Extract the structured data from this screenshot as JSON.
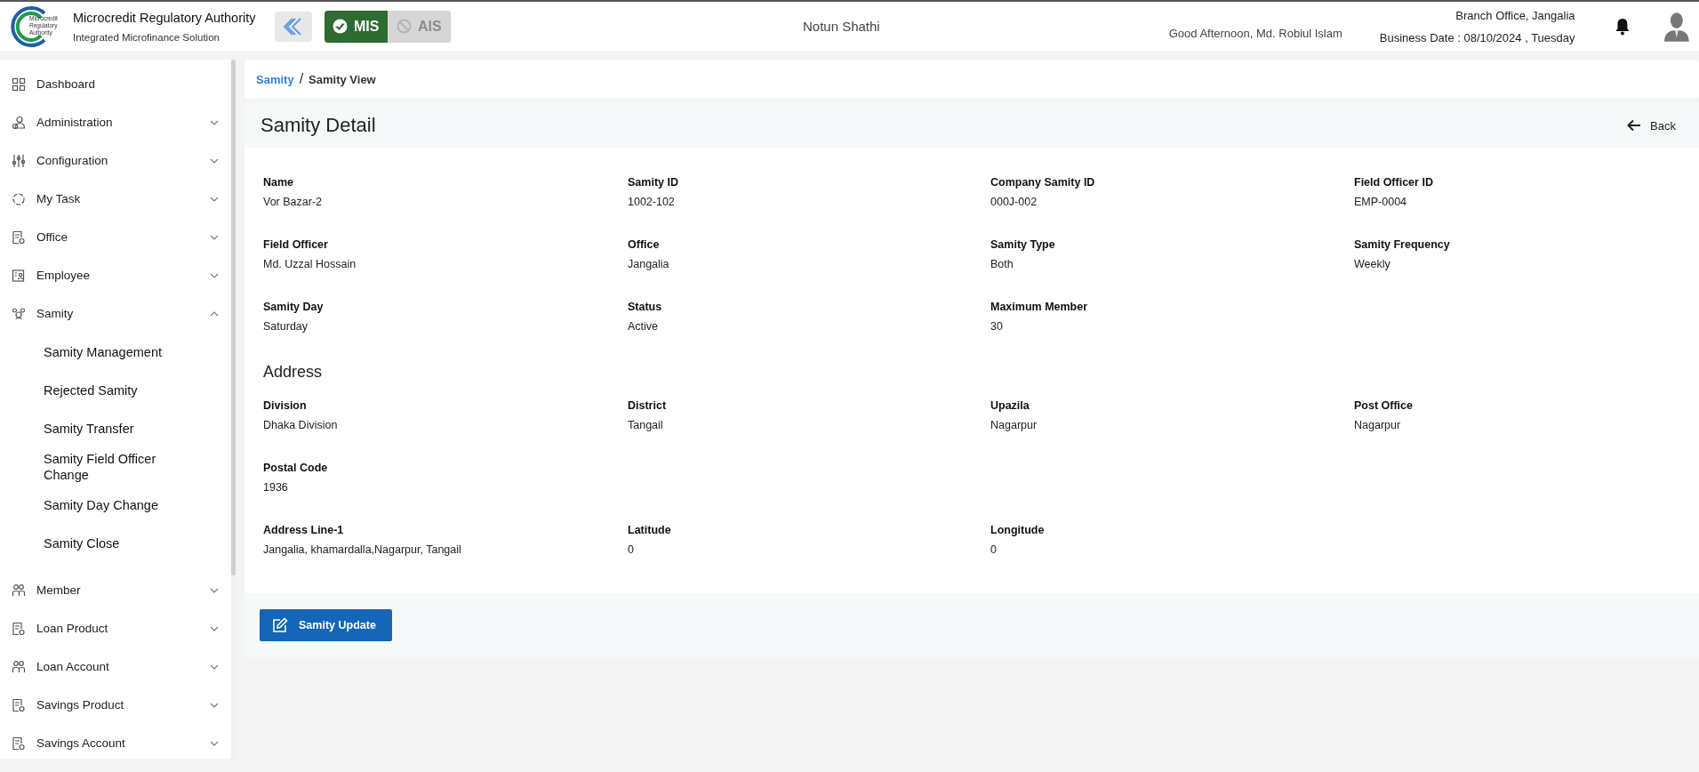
{
  "header": {
    "logo_text": [
      "Microcredit",
      "Regulatory",
      "Authority"
    ],
    "org_name": "Microcredit Regulatory Authority",
    "org_subtitle": "Integrated Microfinance Solution",
    "modules": [
      {
        "label": "MIS",
        "selected": true
      },
      {
        "label": "AIS",
        "selected": false
      }
    ],
    "ngo_name": "Notun Shathi",
    "greeting": "Good Afternoon, Md. Robiul Islam",
    "branch": "Branch Office, Jangalia",
    "business_date": "Business Date : 08/10/2024 , Tuesday"
  },
  "sidebar": {
    "items": [
      {
        "label": "Dashboard",
        "kind": "link"
      },
      {
        "label": "Administration",
        "kind": "group",
        "expanded": false
      },
      {
        "label": "Configuration",
        "kind": "group",
        "expanded": false
      },
      {
        "label": "My Task",
        "kind": "group",
        "expanded": false
      },
      {
        "label": "Office",
        "kind": "group",
        "expanded": false
      },
      {
        "label": "Employee",
        "kind": "group",
        "expanded": false
      },
      {
        "label": "Samity",
        "kind": "group",
        "expanded": true,
        "children": [
          {
            "label": "Samity Management"
          },
          {
            "label": "Rejected Samity"
          },
          {
            "label": "Samity Transfer"
          },
          {
            "label": "Samity Field Officer Change"
          },
          {
            "label": "Samity Day Change"
          },
          {
            "label": "Samity Close"
          }
        ]
      },
      {
        "label": "Member",
        "kind": "group",
        "expanded": false
      },
      {
        "label": "Loan Product",
        "kind": "group",
        "expanded": false
      },
      {
        "label": "Loan Account",
        "kind": "group",
        "expanded": false
      },
      {
        "label": "Savings Product",
        "kind": "group",
        "expanded": false
      },
      {
        "label": "Savings Account",
        "kind": "group",
        "expanded": false
      }
    ]
  },
  "breadcrumb": {
    "link": "Samity",
    "separator": "/",
    "current": "Samity View"
  },
  "detail": {
    "title": "Samity Detail",
    "back": "Back",
    "sections": [
      {
        "rows": [
          [
            {
              "label": "Name",
              "value": "Vor Bazar-2"
            },
            {
              "label": "Samity ID",
              "value": "1002-102"
            },
            {
              "label": "Company Samity ID",
              "value": "000J-002"
            },
            {
              "label": "Field Officer ID",
              "value": "EMP-0004"
            }
          ],
          [
            {
              "label": "Field Officer",
              "value": "Md. Uzzal Hossain"
            },
            {
              "label": "Office",
              "value": "Jangalia"
            },
            {
              "label": "Samity Type",
              "value": "Both"
            },
            {
              "label": "Samity Frequency",
              "value": "Weekly"
            }
          ],
          [
            {
              "label": "Samity Day",
              "value": "Saturday"
            },
            {
              "label": "Status",
              "value": "Active"
            },
            {
              "label": "Maximum Member",
              "value": "30"
            }
          ]
        ]
      },
      {
        "heading": "Address",
        "rows": [
          [
            {
              "label": "Division",
              "value": "Dhaka Division"
            },
            {
              "label": "District",
              "value": "Tangail"
            },
            {
              "label": "Upazila",
              "value": "Nagarpur"
            },
            {
              "label": "Post Office",
              "value": "Nagarpur"
            }
          ],
          [
            {
              "label": "Postal Code",
              "value": "1936"
            }
          ],
          [
            {
              "label": "Address Line-1",
              "value": "Jangalia, khamardalla,Nagarpur, Tangail"
            },
            {
              "label": "Latitude",
              "value": "0"
            },
            {
              "label": "Longitude",
              "value": "0"
            }
          ]
        ]
      }
    ],
    "update_button": "Samity Update"
  }
}
